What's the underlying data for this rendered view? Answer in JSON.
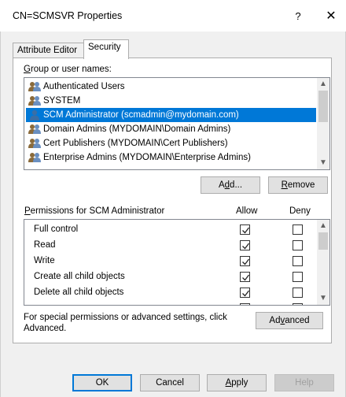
{
  "window": {
    "title": "CN=SCMSVR Properties",
    "help_glyph": "?",
    "close_glyph": "✕"
  },
  "tabs": [
    {
      "label": "Attribute Editor",
      "selected": false
    },
    {
      "label": "Security",
      "selected": true
    }
  ],
  "groups": {
    "label_pre": "",
    "label_u": "G",
    "label_post": "roup or user names:",
    "items": [
      {
        "name": "Authenticated Users",
        "icon": "group-icon",
        "selected": false
      },
      {
        "name": "SYSTEM",
        "icon": "group-icon",
        "selected": false
      },
      {
        "name": "SCM Administrator (scmadmin@mydomain.com)",
        "icon": "user-icon",
        "selected": true
      },
      {
        "name": "Domain Admins (MYDOMAIN\\Domain Admins)",
        "icon": "group-icon",
        "selected": false
      },
      {
        "name": "Cert Publishers (MYDOMAIN\\Cert Publishers)",
        "icon": "group-icon",
        "selected": false
      },
      {
        "name": "Enterprise Admins (MYDOMAIN\\Enterprise Admins)",
        "icon": "group-icon",
        "selected": false
      }
    ],
    "add_pre": "A",
    "add_u": "d",
    "add_post": "d...",
    "remove_pre": "",
    "remove_u": "R",
    "remove_post": "emove"
  },
  "permissions": {
    "header_pre": "",
    "header_u": "P",
    "header_post": "ermissions for SCM Administrator",
    "allow_label": "Allow",
    "deny_label": "Deny",
    "rows": [
      {
        "name": "Full control",
        "allow": true,
        "deny": false
      },
      {
        "name": "Read",
        "allow": true,
        "deny": false
      },
      {
        "name": "Write",
        "allow": true,
        "deny": false
      },
      {
        "name": "Create all child objects",
        "allow": true,
        "deny": false
      },
      {
        "name": "Delete all child objects",
        "allow": true,
        "deny": false
      }
    ]
  },
  "special": {
    "text": "For special permissions or advanced settings, click Advanced.",
    "advanced_pre": "Ad",
    "advanced_u": "v",
    "advanced_post": "anced"
  },
  "footer": {
    "ok": "OK",
    "cancel": "Cancel",
    "apply_pre": "",
    "apply_u": "A",
    "apply_post": "pply",
    "help": "Help"
  },
  "colors": {
    "selection": "#0078d7",
    "group_icon_primary": "#8a6a3a",
    "user_icon_primary": "#3a6ea5"
  }
}
